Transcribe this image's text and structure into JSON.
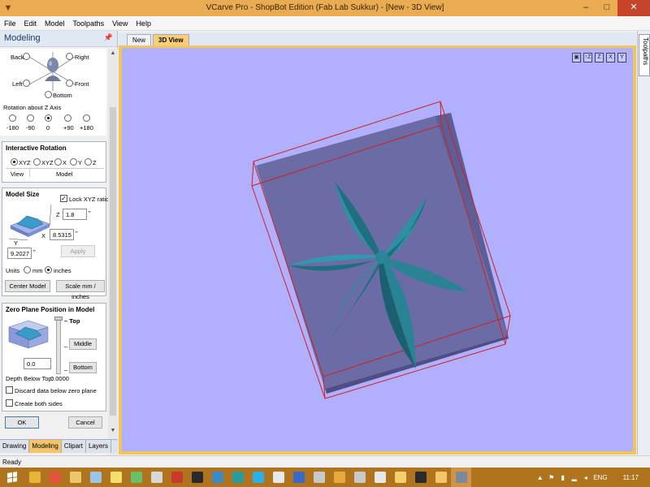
{
  "window": {
    "title": "VCarve Pro - ShopBot Edition (Fab Lab Sukkur) - [New - 3D View]",
    "app_icon": "vcarve-logo-icon",
    "minimize": "–",
    "maximize": "□",
    "close": "✕"
  },
  "menu": [
    "File",
    "Edit",
    "Model",
    "Toolpaths",
    "View",
    "Help"
  ],
  "left_panel": {
    "title": "Modeling",
    "pin_icon": "pin-icon",
    "orientation": {
      "back": "Back",
      "right": "Right",
      "left": "Left",
      "front": "Front",
      "bottom": "Bottom"
    },
    "rotation_z": {
      "label": "Rotation about Z Axis",
      "options": [
        "-180",
        "-90",
        "0",
        "+90",
        "+180"
      ],
      "selected": "0"
    },
    "interactive_rotation": {
      "title": "Interactive Rotation",
      "options": [
        "XYZ",
        "XYZ",
        "X",
        "Y",
        "Z"
      ],
      "selected": 0,
      "view_label": "View",
      "model_label": "Model"
    },
    "model_size": {
      "title": "Model Size",
      "lock_label": "Lock XYZ ratio",
      "lock_checked": true,
      "z_label": "Z",
      "z_value": "1.8",
      "x_label": "X",
      "x_value": "8.5315",
      "y_label": "Y",
      "y_value": "9.2027",
      "unit_mark": "\"",
      "apply_label": "Apply",
      "units_label": "Units",
      "mm_label": "mm",
      "inches_label": "inches",
      "units_selected": "inches",
      "center_model_label": "Center Model",
      "scale_label": "Scale mm / inches"
    },
    "zero_plane": {
      "title": "Zero Plane Position in Model",
      "top_label": "Top",
      "middle_label": "Middle",
      "bottom_label": "Bottom",
      "value": "0.0",
      "depth_label": "Depth Below Top:",
      "depth_value": "0.0000",
      "discard_label": "Discard data below zero plane",
      "both_sides_label": "Create both sides"
    },
    "ok_label": "OK",
    "cancel_label": "Cancel",
    "bottom_tabs": [
      "Drawing",
      "Modeling",
      "Clipart",
      "Layers"
    ],
    "active_tab": "Modeling"
  },
  "doc_tabs": [
    {
      "label": "New",
      "active": false
    },
    {
      "label": "3D View",
      "active": true
    }
  ],
  "view_icons": [
    "▣",
    "↑Z",
    "Z",
    "X",
    "Y"
  ],
  "right_strip": {
    "label": "Toolpaths"
  },
  "status": {
    "text": "Ready"
  },
  "taskbar": {
    "time": "11:17",
    "lang": "ENG",
    "icons": [
      {
        "name": "chrome-icon",
        "color": "#e8b43a"
      },
      {
        "name": "media-icon",
        "color": "#e3553a"
      },
      {
        "name": "explorer-icon",
        "color": "#e8c86a"
      },
      {
        "name": "document-icon",
        "color": "#9cc3e8"
      },
      {
        "name": "tool-icon",
        "color": "#f4e06a"
      },
      {
        "name": "gem-icon",
        "color": "#6ac06a"
      },
      {
        "name": "pdf-icon",
        "color": "#d8d8d8"
      },
      {
        "name": "acrobat-icon",
        "color": "#c83a2a"
      },
      {
        "name": "inkscape-icon",
        "color": "#2a2a2a"
      },
      {
        "name": "fusion-icon",
        "color": "#3a8ac8"
      },
      {
        "name": "arduino-icon",
        "color": "#2a9a9a"
      },
      {
        "name": "skype-icon",
        "color": "#2ab0e8"
      },
      {
        "name": "disc-icon",
        "color": "#e8e8e8"
      },
      {
        "name": "cura-icon",
        "color": "#3a6ac8"
      },
      {
        "name": "eye-icon",
        "color": "#c8c8c8"
      },
      {
        "name": "paint-icon",
        "color": "#e8a83a"
      },
      {
        "name": "settings-icon",
        "color": "#c8c8c8"
      },
      {
        "name": "brush-icon",
        "color": "#e8e8e8"
      },
      {
        "name": "notes-icon",
        "color": "#f4d06a"
      },
      {
        "name": "shopbot-icon",
        "color": "#2a2a2a"
      },
      {
        "name": "folder-icon",
        "color": "#f4c36a"
      },
      {
        "name": "vcarve-icon",
        "color": "#7a8a9a"
      }
    ]
  }
}
